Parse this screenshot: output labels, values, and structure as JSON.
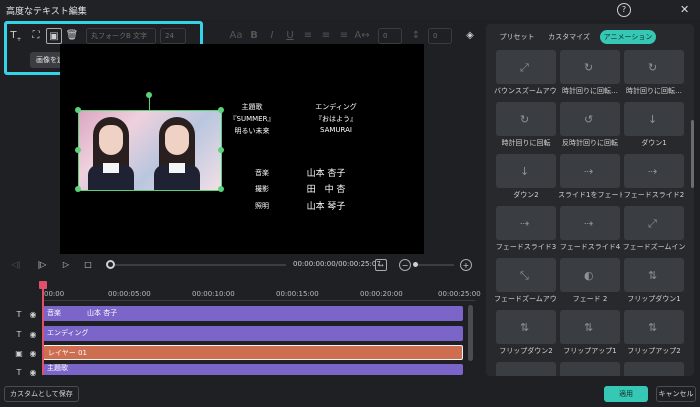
{
  "window": {
    "title": "高度なテキスト編集",
    "help_icon": "?",
    "close_icon": "✕"
  },
  "toolbar": {
    "text_tool": "T",
    "tooltip": "画像を追加",
    "font_placeholder": "丸フォークB 文字も…",
    "font_size": "24",
    "bold": "B",
    "italic": "I",
    "underline": "U",
    "spacing_value_1": "0",
    "spacing_value_2": "0"
  },
  "preview": {
    "credits_left_1": "主題歌",
    "credits_left_2": "『SUMMER』",
    "credits_left_3": "明るい未来",
    "credits_right_1": "エンディング",
    "credits_right_2": "『おはよう』",
    "credits_right_3": "SAMURAI",
    "role_1": "音楽",
    "name_1": "山本 杏子",
    "role_2": "撮影",
    "name_2": "田　中 杏",
    "role_3": "照明",
    "name_3": "山本 琴子"
  },
  "playback": {
    "timecode": "00:00:00:00/00:00:25:07"
  },
  "timeline": {
    "ruler": [
      "00:00",
      "00:00:05:00",
      "00:00:10:00",
      "00:00:15:00",
      "00:00:20:00",
      "00:00:25:00"
    ],
    "tracks": [
      {
        "label": "音楽",
        "sub": "山本 杏子"
      },
      {
        "label": "エンディング",
        "sub": ""
      },
      {
        "label": "レイヤー 01",
        "sub": ""
      },
      {
        "label": "主題歌",
        "sub": ""
      }
    ]
  },
  "panel": {
    "tabs": [
      "プリセット",
      "カスタマイズ",
      "アニメーション"
    ],
    "active_tab": "アニメーション",
    "items": [
      "バウンスズームアウト1",
      "時計回りに回転…",
      "時計回りに回転…",
      "時計回りに回転",
      "反時計回りに回転",
      "ダウン1",
      "ダウン2",
      "スライド1をフェード…",
      "フェードスライド2",
      "フェードスライド3",
      "フェードスライド4",
      "フェードズームイン",
      "フェードズームアウト",
      "フェード 2",
      "フリップダウン1",
      "フリップダウン2",
      "フリップアップ1",
      "フリップアップ2"
    ]
  },
  "footer": {
    "save_custom": "カスタムとして保存",
    "apply": "適用",
    "cancel": "キャンセル"
  },
  "colors": {
    "accent": "#36c8b4",
    "highlight": "#35d3e8",
    "clip_purple": "#7c65c8",
    "clip_orange": "#cd6e50",
    "playhead": "#e0506a"
  }
}
